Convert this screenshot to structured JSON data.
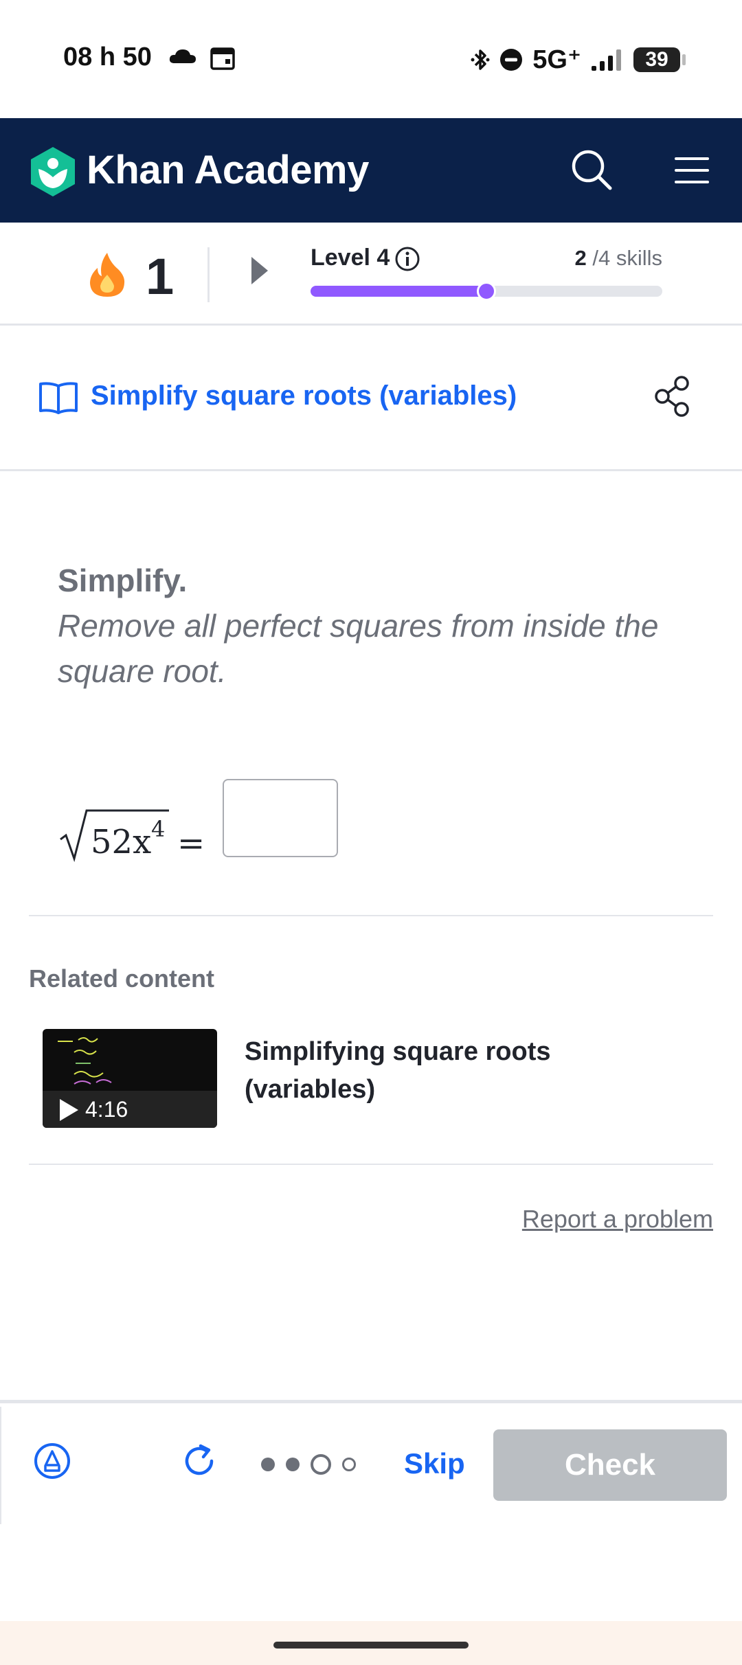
{
  "status_bar": {
    "time": "08 h 50",
    "network": "5G⁺",
    "battery": "39"
  },
  "header": {
    "brand": "Khan Academy"
  },
  "progress": {
    "streak": "1",
    "level": "Level 4",
    "skills_done": "2",
    "skills_total": " /4 skills",
    "level_progress_fraction": 0.5
  },
  "exercise": {
    "title": "Simplify square roots (variables)"
  },
  "question": {
    "heading": "Simplify.",
    "instruction": "Remove all perfect squares from inside the square root.",
    "expression": "52x",
    "exponent": "4",
    "operator": "="
  },
  "related": {
    "label": "Related content",
    "video_title": "Simplifying square roots (variables)",
    "duration": "4:16"
  },
  "report_link": "Report a problem",
  "footer": {
    "skip": "Skip",
    "check": "Check"
  },
  "colors": {
    "brand_navy": "#0b2149",
    "link_blue": "#1865f2",
    "level_purple": "#9059ff",
    "streak_orange": "#ff8c22"
  }
}
